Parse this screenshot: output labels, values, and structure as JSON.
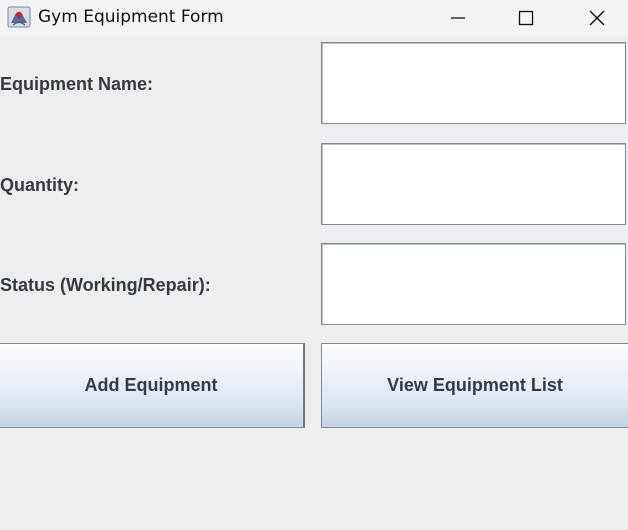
{
  "window": {
    "title": "Gym Equipment Form",
    "icons": {
      "app": "java-app-icon",
      "minimize": "minimize-icon",
      "maximize": "maximize-icon",
      "close": "close-icon"
    }
  },
  "form": {
    "fields": [
      {
        "label": "Equipment Name:",
        "value": ""
      },
      {
        "label": "Quantity:",
        "value": ""
      },
      {
        "label": "Status (Working/Repair):",
        "value": ""
      }
    ],
    "buttons": {
      "add_label": "Add Equipment",
      "view_label": "View Equipment List"
    }
  }
}
